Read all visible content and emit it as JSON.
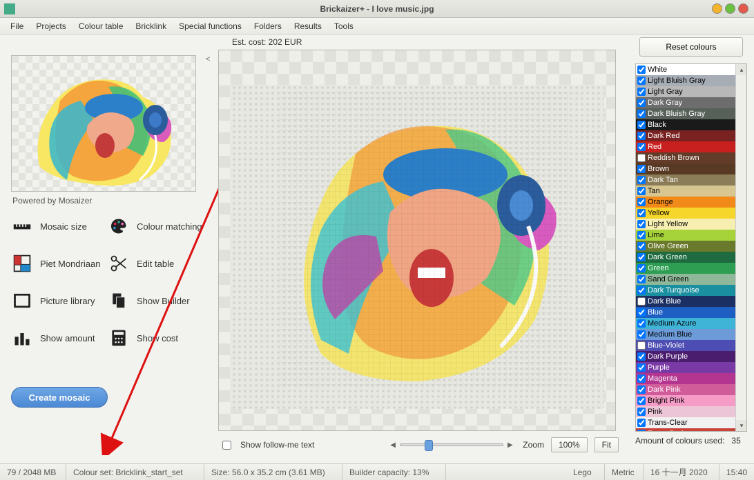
{
  "title": "Brickaizer+  - I love music.jpg",
  "menu": [
    "File",
    "Projects",
    "Colour table",
    "Bricklink",
    "Special functions",
    "Folders",
    "Results",
    "Tools"
  ],
  "powered": "Powered by Mosaizer",
  "tools": {
    "mosaic_size": "Mosaic size",
    "colour_matching": "Colour matching",
    "piet": "Piet Mondriaan",
    "edit_table": "Edit table",
    "picture_library": "Picture library",
    "show_builder": "Show Builder",
    "show_amount": "Show amount",
    "show_cost": "Show cost"
  },
  "create_mosaic": "Create mosaic",
  "est_cost": "Est. cost: 202 EUR",
  "follow_me": "Show follow-me text",
  "zoom_label": "Zoom",
  "zoom_pct": "100%",
  "fit": "Fit",
  "reset_colours": "Reset colours",
  "amount_colours": "Amount of colours used:",
  "amount_value": "35",
  "colours": [
    {
      "name": "White",
      "hex": "#ffffff",
      "text": "#000",
      "checked": true
    },
    {
      "name": "Light Bluish Gray",
      "hex": "#a6adb5",
      "text": "#000",
      "checked": true
    },
    {
      "name": "Light Gray",
      "hex": "#b8b8b8",
      "text": "#000",
      "checked": true
    },
    {
      "name": "Dark Gray",
      "hex": "#6d6d6d",
      "text": "#fff",
      "checked": true
    },
    {
      "name": "Dark Bluish Gray",
      "hex": "#57615a",
      "text": "#fff",
      "checked": true
    },
    {
      "name": "Black",
      "hex": "#1a1a1a",
      "text": "#fff",
      "checked": true
    },
    {
      "name": "Dark Red",
      "hex": "#7a2222",
      "text": "#fff",
      "checked": true
    },
    {
      "name": "Red",
      "hex": "#c8201e",
      "text": "#fff",
      "checked": true
    },
    {
      "name": "Reddish Brown",
      "hex": "#633c29",
      "text": "#fff",
      "checked": false
    },
    {
      "name": "Brown",
      "hex": "#583a24",
      "text": "#fff",
      "checked": true
    },
    {
      "name": "Dark Tan",
      "hex": "#8b7d58",
      "text": "#fff",
      "checked": true
    },
    {
      "name": "Tan",
      "hex": "#d7c690",
      "text": "#000",
      "checked": true
    },
    {
      "name": "Orange",
      "hex": "#f28a1a",
      "text": "#000",
      "checked": true
    },
    {
      "name": "Yellow",
      "hex": "#f7d62c",
      "text": "#000",
      "checked": true
    },
    {
      "name": "Light Yellow",
      "hex": "#f7efb2",
      "text": "#000",
      "checked": true
    },
    {
      "name": "Lime",
      "hex": "#a6d33a",
      "text": "#000",
      "checked": true
    },
    {
      "name": "Olive Green",
      "hex": "#6a7a2c",
      "text": "#fff",
      "checked": true
    },
    {
      "name": "Dark Green",
      "hex": "#1e6b3f",
      "text": "#fff",
      "checked": true
    },
    {
      "name": "Green",
      "hex": "#2e9e53",
      "text": "#fff",
      "checked": true
    },
    {
      "name": "Sand Green",
      "hex": "#8fb79a",
      "text": "#000",
      "checked": true
    },
    {
      "name": "Dark Turquoise",
      "hex": "#1a8fa0",
      "text": "#fff",
      "checked": true
    },
    {
      "name": "Dark Blue",
      "hex": "#1c2f63",
      "text": "#fff",
      "checked": false
    },
    {
      "name": "Blue",
      "hex": "#1d5fc2",
      "text": "#fff",
      "checked": true
    },
    {
      "name": "Medium Azure",
      "hex": "#3fb4d6",
      "text": "#000",
      "checked": true
    },
    {
      "name": "Medium Blue",
      "hex": "#6c9bd8",
      "text": "#000",
      "checked": true
    },
    {
      "name": "Blue-Violet",
      "hex": "#4d4db3",
      "text": "#fff",
      "checked": false
    },
    {
      "name": "Dark Purple",
      "hex": "#4a1d6f",
      "text": "#fff",
      "checked": true
    },
    {
      "name": "Purple",
      "hex": "#7a3aa6",
      "text": "#fff",
      "checked": true
    },
    {
      "name": "Magenta",
      "hex": "#b33590",
      "text": "#fff",
      "checked": true
    },
    {
      "name": "Dark Pink",
      "hex": "#d15c9a",
      "text": "#fff",
      "checked": true
    },
    {
      "name": "Bright Pink",
      "hex": "#f49bc6",
      "text": "#000",
      "checked": true
    },
    {
      "name": "Pink",
      "hex": "#ecc6d6",
      "text": "#000",
      "checked": true
    },
    {
      "name": "Trans-Clear",
      "hex": "#f1f1f1",
      "text": "#000",
      "checked": true
    },
    {
      "name": "Trans-Red",
      "hex": "#c8423a",
      "text": "#fff",
      "checked": true
    }
  ],
  "status": {
    "mem": "79 / 2048 MB",
    "colourset": "Colour set: Bricklink_start_set",
    "size": "Size: 56.0 x 35.2 cm (3.61 MB)",
    "builder": "Builder capacity: 13%",
    "lego": "Lego",
    "metric": "Metric",
    "date": "16 十一月 2020",
    "time": "15:40"
  }
}
